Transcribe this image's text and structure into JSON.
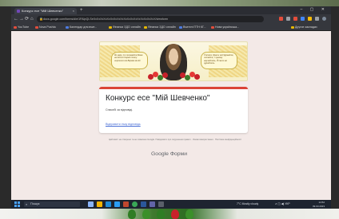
{
  "browser": {
    "tab_title": "Конкурс есе \"Мій Шевченко\"",
    "tab_close": "×",
    "new_tab": "+",
    "window_controls": "– ▢ ✕",
    "url": "docs.google.com/forms/d/e/1FAIpQLSeXxXxXxXxXxXxXxXxXxXxXxXxXxXxXxXxXxXxX/viewform",
    "nav": {
      "back": "←",
      "forward": "→",
      "reload": "⟳",
      "home": "⌂"
    },
    "bookmarks": [
      "YouTube",
      "Nova Poshta",
      "Календар для вчит...",
      "Фінанси ЗДО онлайн",
      "Фінанси ЗДО онлайн",
      "Вчителі ПТН КГ...",
      "Нова українська...",
      "Другие закладки"
    ]
  },
  "banner": {
    "poem_left": "Як умру, то поховайте Мене на могилі Серед степу широкого На Вкраїні милій",
    "poem_right": "Учітеся, брати мої! Думайте, читайте, І чужому научайтесь, Й свого не цурайтесь"
  },
  "form": {
    "title": "Конкурс есе \"Мій Шевченко\"",
    "description": "Спасибі за відповіді.",
    "edit_link": "Відправити іншу відповідь"
  },
  "footer": {
    "disclaimer": "Цей вміст не створено та не схвалено Google. Повідомити про порушення правил · Умови використання · Політика конфіденційності",
    "google": "Google",
    "forms": "Форми"
  },
  "taskbar": {
    "search_placeholder": "Пошук",
    "weather": "7°C Mostly cloudy",
    "tray": "∧ ◫ ◀) УКР",
    "time": "14:52",
    "date": "09.03.2023"
  },
  "colors": {
    "form_accent": "#db4437",
    "page_bg": "#f3e9e7",
    "link": "#4a6fd6"
  }
}
